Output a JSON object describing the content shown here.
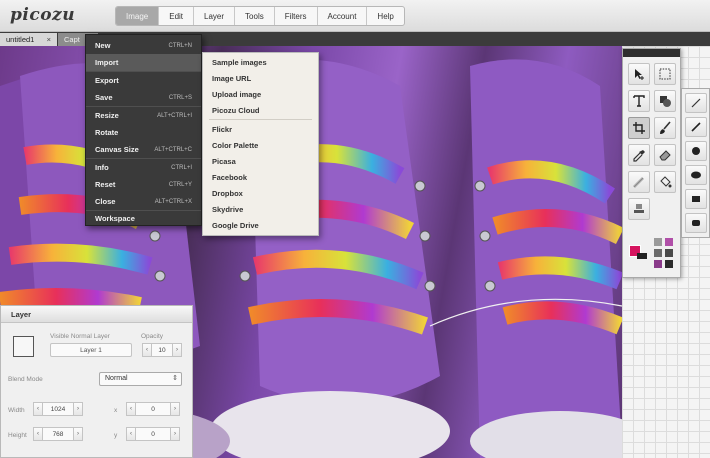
{
  "app": {
    "logo": "picozu"
  },
  "menubar": [
    {
      "label": "Image",
      "active": true
    },
    {
      "label": "Edit",
      "active": false
    },
    {
      "label": "Layer",
      "active": false
    },
    {
      "label": "Tools",
      "active": false
    },
    {
      "label": "Filters",
      "active": false
    },
    {
      "label": "Account",
      "active": false
    },
    {
      "label": "Help",
      "active": false
    }
  ],
  "doc_tabs": [
    {
      "label": "untitled1",
      "close": "×"
    },
    {
      "label": "Capt"
    }
  ],
  "image_menu": [
    {
      "label": "New",
      "shortcut": "CTRL+N"
    },
    {
      "label": "Import",
      "shortcut": ""
    },
    {
      "label": "Export",
      "shortcut": ""
    },
    {
      "label": "Save",
      "shortcut": "CTRL+S"
    },
    {
      "label": "Resize",
      "shortcut": "ALT+CTRL+I"
    },
    {
      "label": "Rotate",
      "shortcut": ""
    },
    {
      "label": "Canvas Size",
      "shortcut": "ALT+CTRL+C"
    },
    {
      "label": "Info",
      "shortcut": "CTRL+I"
    },
    {
      "label": "Reset",
      "shortcut": "CTRL+Y"
    },
    {
      "label": "Close",
      "shortcut": "ALT+CTRL+X"
    },
    {
      "label": "Workspace",
      "shortcut": ""
    }
  ],
  "import_submenu": [
    "Sample images",
    "Image URL",
    "Upload image",
    "Picozu Cloud",
    "Flickr",
    "Color Palette",
    "Picasa",
    "Facebook",
    "Dropbox",
    "Skydrive",
    "Google Drive"
  ],
  "layer_panel": {
    "title": "Layer",
    "visible_label": "Visible Normal Layer",
    "opacity_label": "Opacity",
    "layer_name": "Layer 1",
    "opacity_value": "10",
    "blend_label": "Blend Mode",
    "blend_value": "Normal",
    "width_label": "Width",
    "width_value": "1024",
    "height_label": "Height",
    "height_value": "768",
    "x_label": "x",
    "x_value": "0",
    "y_label": "y",
    "y_value": "0",
    "dec": "‹",
    "inc": "›",
    "arrow": "⇕"
  },
  "colors": {
    "primary": "#d6145f",
    "secondary": "#222222",
    "swatches": [
      "#9a9a9a",
      "#b04fa8",
      "#6a6a6a",
      "#4a4a4a",
      "#8a3a8a",
      "#2a2a2a"
    ]
  }
}
